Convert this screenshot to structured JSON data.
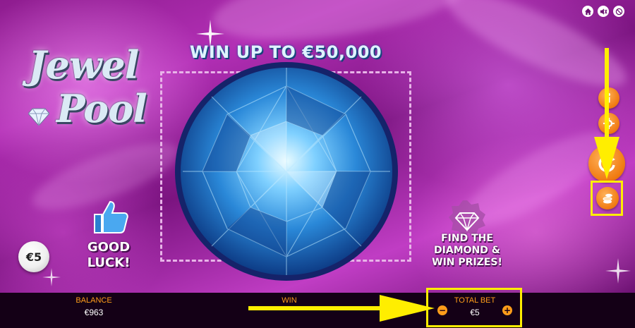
{
  "game": {
    "logo_line1": "Jewel",
    "logo_line2": "Pool",
    "headline": "WIN UP TO €50,000",
    "good_luck_line1": "GOOD",
    "good_luck_line2": "LUCK!",
    "coin_value": "€5",
    "promo_line1": "FIND THE",
    "promo_line2": "DIAMOND &",
    "promo_line3": "WIN PRIZES!"
  },
  "top_controls": {
    "items": [
      {
        "icon": "home-icon"
      },
      {
        "icon": "sound-mute-icon"
      },
      {
        "icon": "no-turbo-icon"
      }
    ]
  },
  "side_controls": {
    "items": [
      {
        "icon": "info-icon"
      },
      {
        "icon": "settings-icon"
      },
      {
        "icon": "play-refresh-icon"
      },
      {
        "icon": "coins-bet-icon"
      }
    ]
  },
  "bottom_bar": {
    "balance_label": "BALANCE",
    "balance_value": "€963",
    "win_label": "WIN",
    "total_bet_label": "TOTAL BET",
    "total_bet_value": "€5",
    "decrease_symbol": "−",
    "increase_symbol": "+"
  },
  "colors": {
    "accent_orange": "#ff9d1a",
    "highlight_yellow": "#ffee00",
    "background_magenta": "#b22fb5",
    "gem_blue": "#3aa3e8"
  }
}
